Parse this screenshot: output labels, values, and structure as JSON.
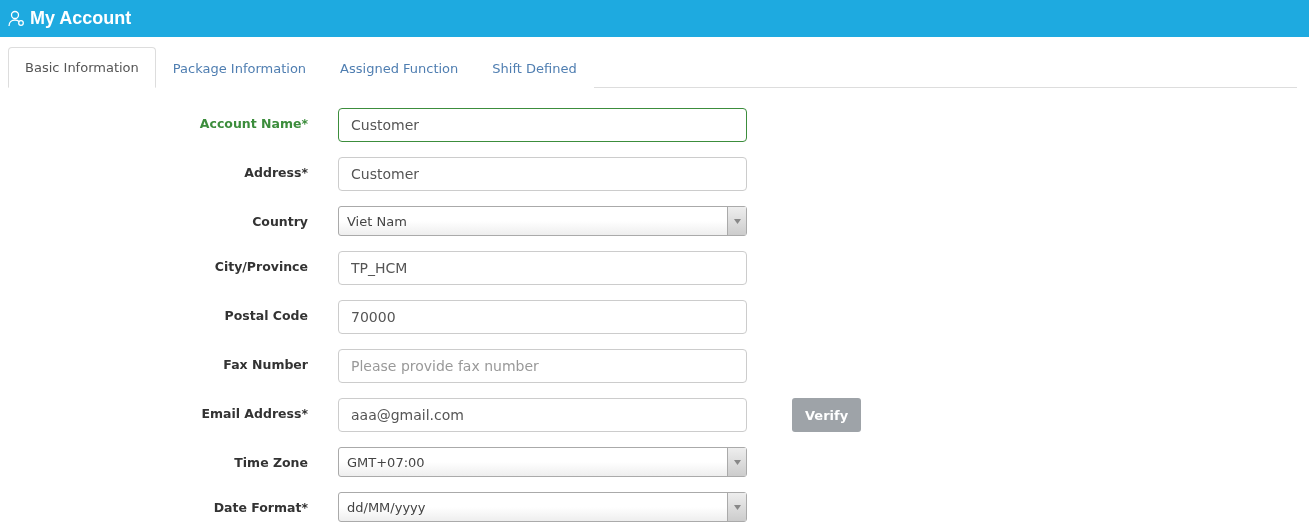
{
  "header": {
    "title": "My Account"
  },
  "tabs": [
    {
      "label": "Basic Information",
      "selected": true
    },
    {
      "label": "Package Information",
      "selected": false
    },
    {
      "label": "Assigned Function",
      "selected": false
    },
    {
      "label": "Shift Defined",
      "selected": false
    }
  ],
  "fields": [
    {
      "kind": "text",
      "label": "Account Name*",
      "value": "Customer",
      "focused": true
    },
    {
      "kind": "text",
      "label": "Address*",
      "value": "Customer",
      "focused": false
    },
    {
      "kind": "select",
      "label": "Country",
      "value": "Viet Nam",
      "focused": false
    },
    {
      "kind": "text",
      "label": "City/Province",
      "value": "TP_HCM",
      "focused": false
    },
    {
      "kind": "text",
      "label": "Postal Code",
      "value": "70000",
      "focused": false
    },
    {
      "kind": "text",
      "label": "Fax Number",
      "placeholder": "Please provide fax number",
      "focused": false
    },
    {
      "kind": "text",
      "label": "Email Address*",
      "value": "aaa@gmail.com",
      "focused": false,
      "button": "Verify"
    },
    {
      "kind": "select",
      "label": "Time Zone",
      "value": "GMT+07:00",
      "focused": false
    },
    {
      "kind": "select",
      "label": "Date Format*",
      "value": "dd/MM/yyyy",
      "focused": false
    }
  ]
}
